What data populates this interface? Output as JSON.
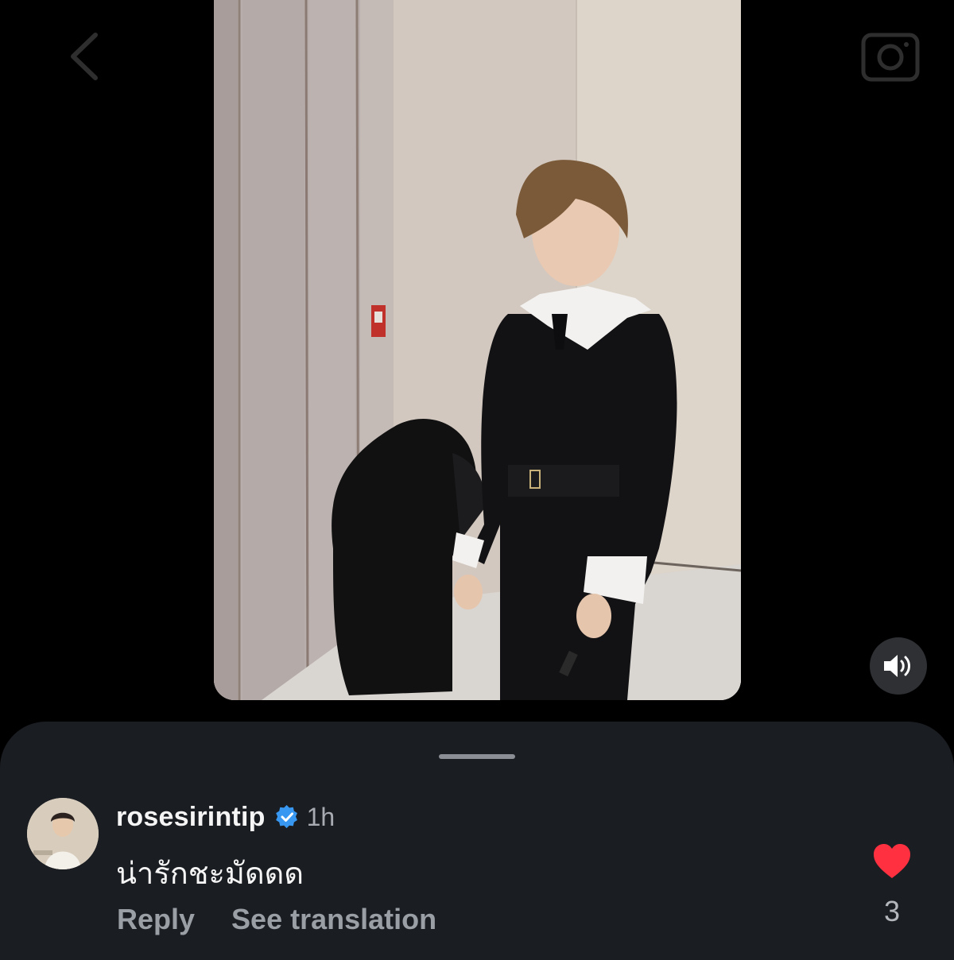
{
  "nav": {
    "back_icon": "chevron-left-icon",
    "camera_icon": "camera-icon"
  },
  "media": {
    "sound_icon": "speaker-icon",
    "wall_sign": ""
  },
  "comment": {
    "username": "rosesirintip",
    "verified_icon": "verified-badge-icon",
    "time": "1h",
    "text": "น่ารักชะมัดดด",
    "reply_label": "Reply",
    "translate_label": "See translation",
    "like_icon": "heart-icon",
    "like_count": "3"
  },
  "colors": {
    "background": "#000000",
    "sheet": "#1a1d22",
    "verified": "#3897f0",
    "like": "#ff3040",
    "muted_text": "#9a9ea5"
  }
}
